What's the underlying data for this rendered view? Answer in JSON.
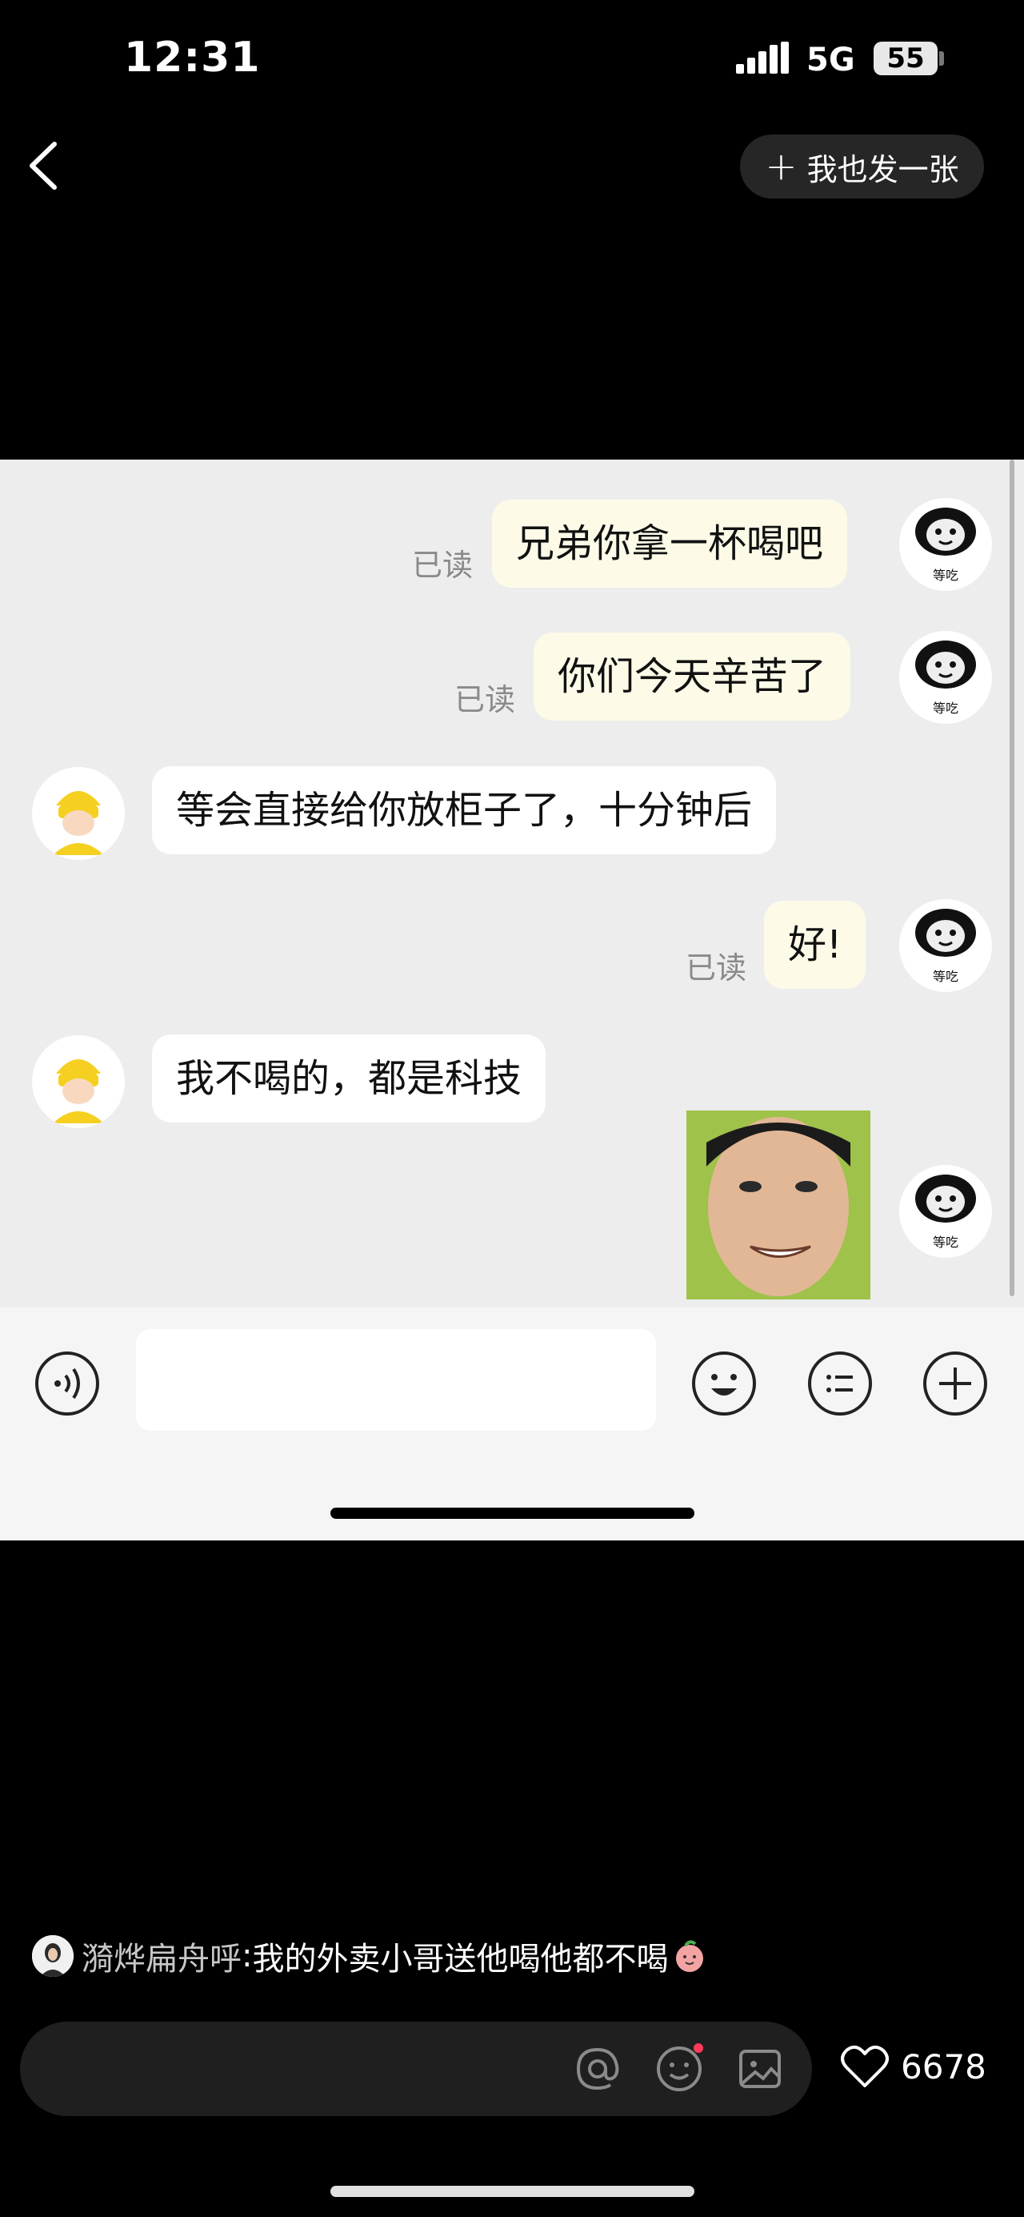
{
  "status_bar": {
    "time": "12:31",
    "network": "5G",
    "battery": "55"
  },
  "top_bar": {
    "post_label": "我也发一张"
  },
  "chat": {
    "messages": [
      {
        "side": "me",
        "text": "兄弟你拿一杯喝吧",
        "read": "已读"
      },
      {
        "side": "me",
        "text": "你们今天辛苦了",
        "read": "已读"
      },
      {
        "side": "other",
        "text": "等会直接给你放柜子了，十分钟后"
      },
      {
        "side": "me",
        "text": "好!",
        "read": "已读"
      },
      {
        "side": "other",
        "text": "我不喝的，都是科技"
      },
      {
        "side": "me",
        "type": "image"
      }
    ],
    "avatar_caption": "等吃"
  },
  "comment": {
    "user": "漪烨扁舟呼",
    "text": "我的外卖小哥送他喝他都不喝"
  },
  "bottom": {
    "likes": "6678"
  },
  "icons": [
    "back-icon",
    "plus-icon",
    "voice-icon",
    "emoji-icon",
    "menu-icon",
    "add-icon",
    "at-icon",
    "smile-icon",
    "image-icon",
    "heart-icon"
  ]
}
